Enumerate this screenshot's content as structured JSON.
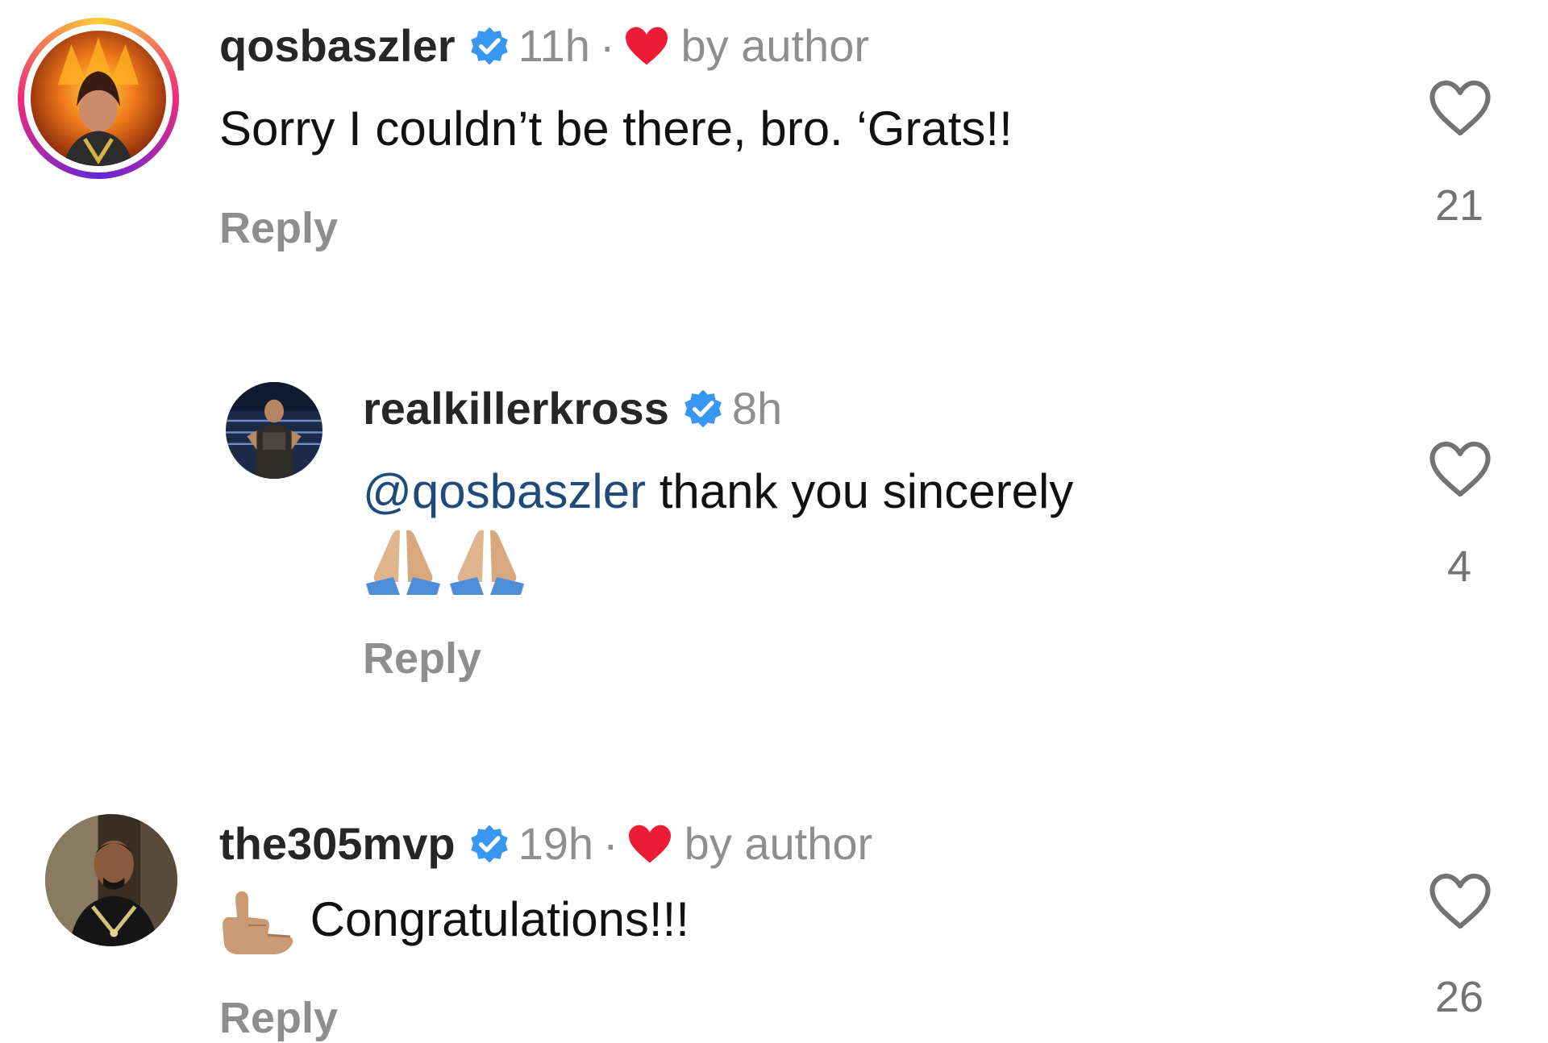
{
  "comments": [
    {
      "username": "qosbaszler",
      "time": "11h",
      "separator": "·",
      "liked_by_author": "by author",
      "text": "Sorry I couldn’t be there, bro. ‘Grats!!",
      "reply_label": "Reply",
      "likes": "21",
      "avatar_icon": "fiery-portrait-avatar",
      "has_story_ring": true
    },
    {
      "username": "realkillerkross",
      "time": "8h",
      "mention": "@qosbaszler",
      "text": " thank you sincerely",
      "emojis": [
        "folded-hands-emoji",
        "folded-hands-emoji"
      ],
      "reply_label": "Reply",
      "likes": "4",
      "avatar_icon": "wrestler-in-ring-avatar",
      "is_reply": true
    },
    {
      "username": "the305mvp",
      "time": "19h",
      "separator": "·",
      "liked_by_author": "by author",
      "emoji": "call-me-hand-emoji",
      "text": " Congratulations!!!",
      "reply_label": "Reply",
      "likes": "26",
      "avatar_icon": "man-portrait-avatar"
    }
  ],
  "colors": {
    "username": "#262626",
    "meta": "#8e8e8e",
    "mention": "#1f4a7d",
    "verified": "#3897f0",
    "author_heart": "#ed1c34"
  }
}
